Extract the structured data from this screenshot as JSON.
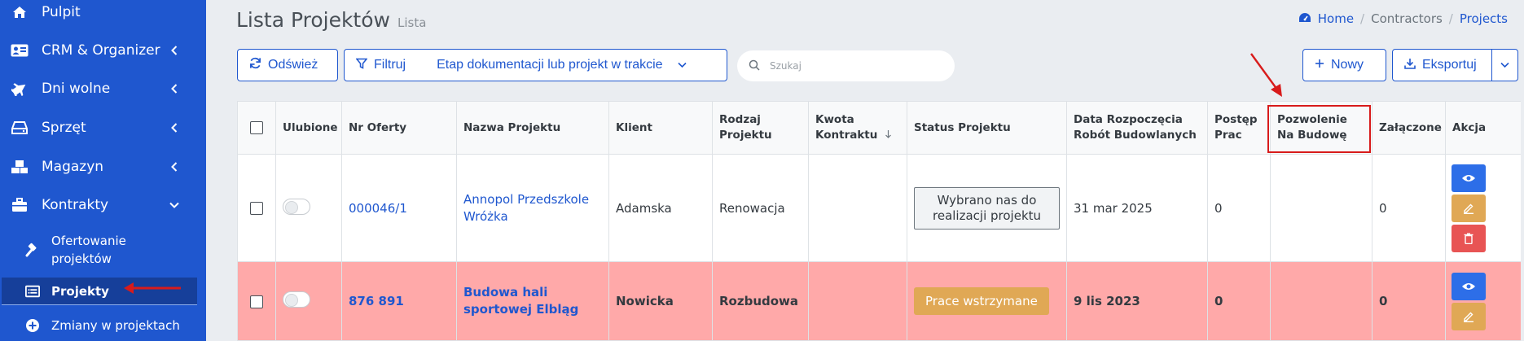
{
  "sidebar": {
    "items": [
      {
        "label": "Pulpit",
        "icon": "home-icon"
      },
      {
        "label": "CRM & Organizer",
        "icon": "address-card-icon"
      },
      {
        "label": "Dni wolne",
        "icon": "plane-icon"
      },
      {
        "label": "Sprzęt",
        "icon": "hdd-icon"
      },
      {
        "label": "Magazyn",
        "icon": "boxes-icon"
      },
      {
        "label": "Kontrakty",
        "icon": "briefcase-icon"
      }
    ],
    "sub_items": [
      {
        "label": "Ofertowanie projektów",
        "icon": "gavel-icon"
      },
      {
        "label": "Projekty",
        "icon": "list-icon"
      },
      {
        "label": "Zmiany w projektach",
        "icon": "plus-circle-icon"
      }
    ]
  },
  "header": {
    "title": "Lista Projektów",
    "subtitle": "Lista",
    "breadcrumb": {
      "home": "Home",
      "contractors": "Contractors",
      "projects": "Projects"
    }
  },
  "toolbar": {
    "refresh_label": "Odśwież",
    "filter_label": "Filtruj",
    "filter_value": "Etap dokumentacji lub projekt w trakcie",
    "search_placeholder": "Szukaj",
    "new_label": "Nowy",
    "export_label": "Eksportuj"
  },
  "table": {
    "headers": {
      "favorite": "Ulubione",
      "offer_no": "Nr Oferty",
      "project_name": "Nazwa Projektu",
      "client": "Klient",
      "project_type": "Rodzaj Projektu",
      "contract_amount": "Kwota Kontraktu",
      "status": "Status Projektu",
      "start_date": "Data Rozpoczęcia Robót Budowlanych",
      "progress": "Postęp Prac",
      "permit": "Pozwolenie Na Budowę",
      "attached": "Załączone",
      "action": "Akcja"
    },
    "rows": [
      {
        "offer_no": "000046/1",
        "project_name": "Annopol Przedszkole Wróżka",
        "client": "Adamska",
        "project_type": "Renowacja",
        "contract_amount": "",
        "status": "Wybrano nas do realizacji projektu",
        "start_date": "31 mar 2025",
        "progress": "0",
        "permit": "",
        "attached": "0"
      },
      {
        "offer_no": "876 891",
        "project_name": "Budowa hali sportowej Elbląg",
        "client": "Nowicka",
        "project_type": "Rozbudowa",
        "contract_amount": "",
        "status": "Prace wstrzymane",
        "start_date": "9 lis 2023",
        "progress": "0",
        "permit": "",
        "attached": "0"
      }
    ]
  },
  "colors": {
    "sidebar_bg": "#1f57cf",
    "accent": "#1f57cf",
    "highlight_row": "#ffa9a9",
    "warning": "#e0a855",
    "danger": "#e85454",
    "annotation_red": "#d81b1b"
  }
}
